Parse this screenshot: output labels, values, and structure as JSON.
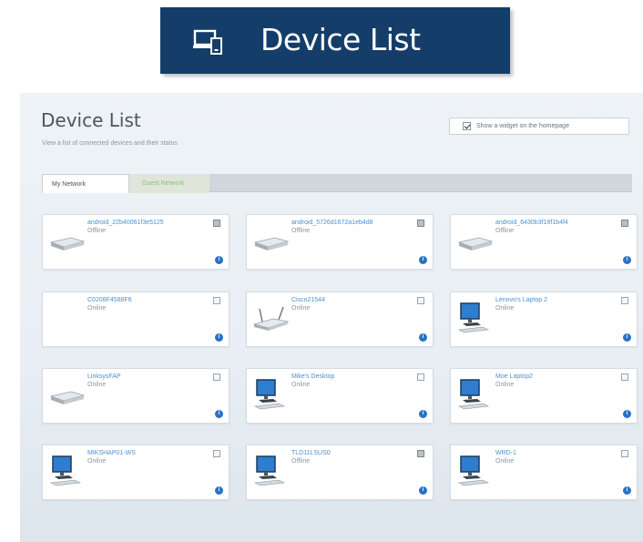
{
  "banner": {
    "title": "Device List",
    "icon": "devices-icon",
    "background": "#143e69"
  },
  "panel": {
    "title": "Device List",
    "subtitle": "View a list of connected devices and their status",
    "widget_label": "Show a widget on the homepage",
    "widget_checked": true
  },
  "tabs": [
    {
      "label": "My Network",
      "active": true
    },
    {
      "label": "Guest Network",
      "active": false
    }
  ],
  "devices": [
    {
      "name": "android_22b40061f3e5125",
      "status": "Offline",
      "icon": "drive-icon"
    },
    {
      "name": "android_5726d1672a1eb4d8",
      "status": "Offline",
      "icon": "drive-icon"
    },
    {
      "name": "android_6430b3f18f1b4f4",
      "status": "Offline",
      "icon": "drive-icon"
    },
    {
      "name": "C0208F4588F6",
      "status": "Online",
      "icon": "none"
    },
    {
      "name": "Cisco21544",
      "status": "Online",
      "icon": "router-icon"
    },
    {
      "name": "Lenovo's Laptop 2",
      "status": "Online",
      "icon": "computer-icon"
    },
    {
      "name": "LinksysFAP",
      "status": "Online",
      "icon": "drive-icon"
    },
    {
      "name": "Mike's Desktop",
      "status": "Online",
      "icon": "computer-icon"
    },
    {
      "name": "Moe Laptop2",
      "status": "Online",
      "icon": "computer-icon"
    },
    {
      "name": "MIKSHAP01-WS",
      "status": "Online",
      "icon": "computer-icon"
    },
    {
      "name": "TLD11LSUS0",
      "status": "Offline",
      "icon": "computer-icon"
    },
    {
      "name": "WRD-1",
      "status": "Online",
      "icon": "computer-icon"
    }
  ]
}
